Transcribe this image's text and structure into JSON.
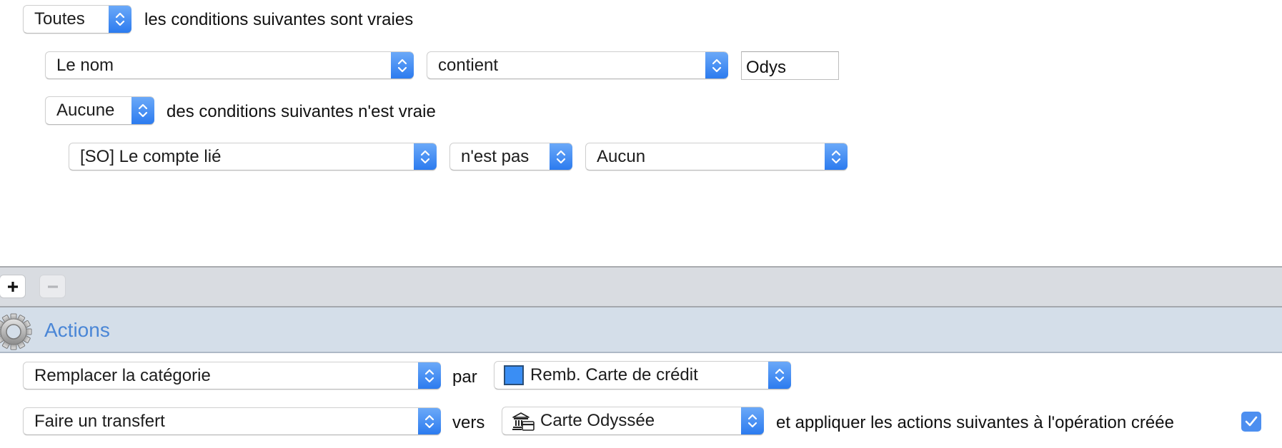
{
  "conditions": {
    "root": {
      "quantifier": "Toutes",
      "suffix": "les conditions suivantes sont vraies"
    },
    "rule1": {
      "field": "Le nom",
      "operator": "contient",
      "value": "Odys"
    },
    "group": {
      "quantifier": "Aucune",
      "suffix": "des conditions suivantes n'est vraie"
    },
    "rule2": {
      "field": "[SO] Le compte lié",
      "operator": "n'est pas",
      "value": "Aucun"
    }
  },
  "toolbar": {
    "add_label": "+",
    "remove_label": "−",
    "add_icon": "plus-icon",
    "remove_icon": "minus-icon"
  },
  "actions": {
    "title": "Actions",
    "icon": "gear-icon",
    "rows": [
      {
        "action": "Remplacer la catégorie",
        "connector": "par",
        "target": "Remb. Carte de crédit",
        "target_icon": "color-swatch",
        "target_color": "#3a8ef4"
      },
      {
        "action": "Faire un transfert",
        "connector": "vers",
        "target": "Carte Odyssée",
        "target_icon": "bank-card-icon",
        "trailing_text": "et appliquer les actions suivantes à l'opération créée",
        "checkbox_checked": true
      }
    ]
  },
  "colors": {
    "accent": "#2c7bef",
    "actions_header_text": "#4a86d6",
    "actions_band": "#d4dee9",
    "toolbar_band": "#d9dce1",
    "checkbox": "#4d8ff0"
  }
}
